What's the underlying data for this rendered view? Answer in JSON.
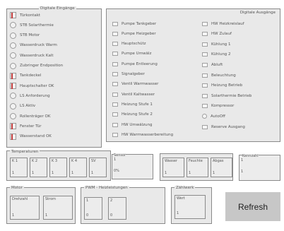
{
  "digitale_eingaenge": {
    "title": "Digitale Eingänge",
    "items": [
      {
        "label": "Türkontakt",
        "on": true
      },
      {
        "label": "STB Solarthermie",
        "on": false
      },
      {
        "label": "STB Motor",
        "on": false
      },
      {
        "label": "Wasserdruck Warm",
        "on": false
      },
      {
        "label": "Wasserdruck Kalt",
        "on": false
      },
      {
        "label": "Zubringer Endposition",
        "on": false
      },
      {
        "label": "Tankdeckel",
        "on": true
      },
      {
        "label": "Hauptschalter OK",
        "on": true
      },
      {
        "label": "LS Anforderung",
        "on": false
      },
      {
        "label": "LS Aktiv",
        "on": false
      },
      {
        "label": "Rollenträger OK",
        "on": false
      },
      {
        "label": "Fenster Tür",
        "on": true
      },
      {
        "label": "Wasserstand OK",
        "on": true
      }
    ]
  },
  "digitale_ausgaenge": {
    "title": "Digitale Ausgänge",
    "left": [
      "Pumpe Tankgeber",
      "Pumpe Heizgeber",
      "Hauptschütz",
      "Pumpe Umwälz",
      "Pumpe Entleerung",
      "Signalgeber",
      "Ventil Warmwasser",
      "Ventil Kaltwasser",
      "Heizung Stufe 1",
      "Heizung Stufe 2",
      "HW Umwälzung",
      "HW Warmwasserbereitung"
    ],
    "right": [
      "HW Heizkreislauf",
      "HW Zulauf",
      "Kühlung 1",
      "Kühlung 2",
      "Abluft",
      "Beleuchtung",
      "Heizung Betrieb",
      "Solarthermie Betrieb",
      "Kompressor",
      "AutoOff",
      "Reserve Ausgang"
    ],
    "right_round_index": 9
  },
  "temperaturen": {
    "title": "Temperaturen",
    "fields": [
      {
        "label": "K 1",
        "value": "1"
      },
      {
        "label": "K 2",
        "value": "1"
      },
      {
        "label": "K 3",
        "value": "1"
      },
      {
        "label": "K 4",
        "value": "1"
      },
      {
        "label": "SV",
        "value": "1"
      }
    ]
  },
  "sensor": {
    "title": "Sensor",
    "label": "1",
    "value": "0%"
  },
  "wasser_group": {
    "fields": [
      {
        "label": "Wasser",
        "value": "1"
      },
      {
        "label": "Feuchte",
        "value": "1"
      },
      {
        "label": "Abgas",
        "value": "1"
      }
    ]
  },
  "kennzahl": {
    "title": "Kennzahl",
    "label": "1",
    "value": "1"
  },
  "motor": {
    "title": "Motor",
    "fields": [
      {
        "label": "Drehzahl",
        "value": "1"
      },
      {
        "label": "Strom",
        "value": "1"
      }
    ]
  },
  "pwm": {
    "title": "PWM - Heizleistungen",
    "fields": [
      {
        "label": "1",
        "value": "0"
      },
      {
        "label": "2",
        "value": "0"
      }
    ]
  },
  "zaehlwerk": {
    "title": "Zählwerk",
    "label": "Wert",
    "value": "1"
  },
  "refresh_label": "Refresh"
}
